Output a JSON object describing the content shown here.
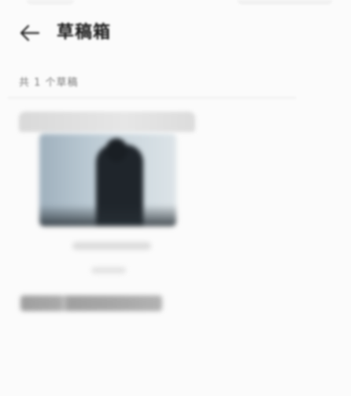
{
  "header": {
    "back_icon": "arrow-left-icon",
    "title": "草稿箱"
  },
  "drafts": {
    "count_text": "共 1 个草稿"
  },
  "colors": {
    "background": "#fbfbfb",
    "title_text": "#1a1a1a",
    "secondary_text": "#7a7a7a",
    "divider": "#e6e6e6"
  }
}
